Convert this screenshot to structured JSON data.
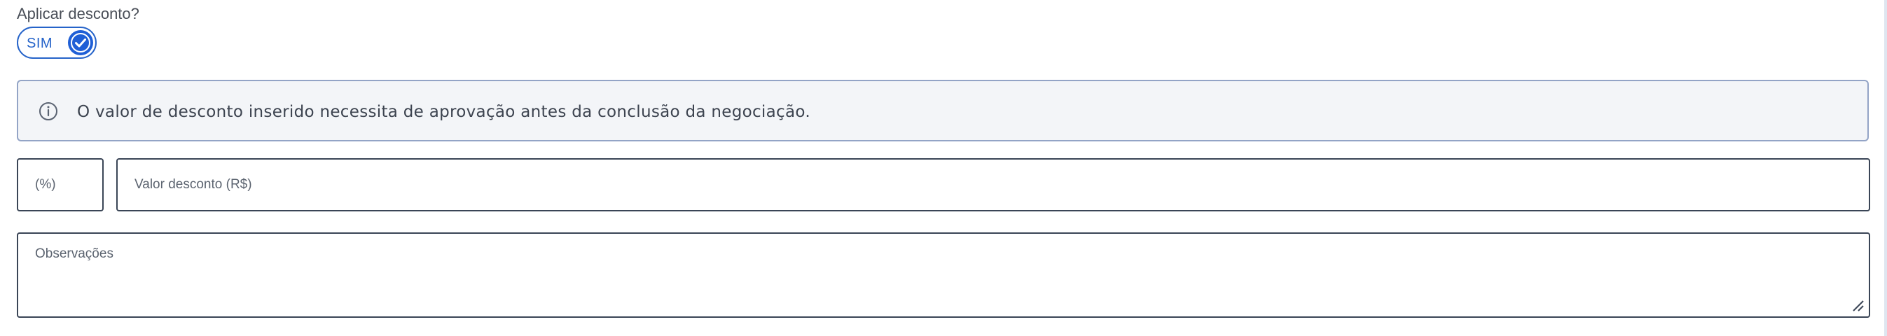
{
  "discount_question": {
    "label": "Aplicar desconto?"
  },
  "discount_toggle": {
    "label": "SIM",
    "checked": true,
    "accent_color": "#2563c9"
  },
  "info_banner": {
    "icon": "info-circle-icon",
    "text": "O valor de desconto inserido necessita de aprovação antes da conclusão da negociação."
  },
  "discount_percent": {
    "value": "",
    "placeholder": "(%)"
  },
  "discount_value": {
    "value": "",
    "placeholder": "Valor desconto (R$)"
  },
  "observations": {
    "value": "",
    "placeholder": "Observações"
  }
}
